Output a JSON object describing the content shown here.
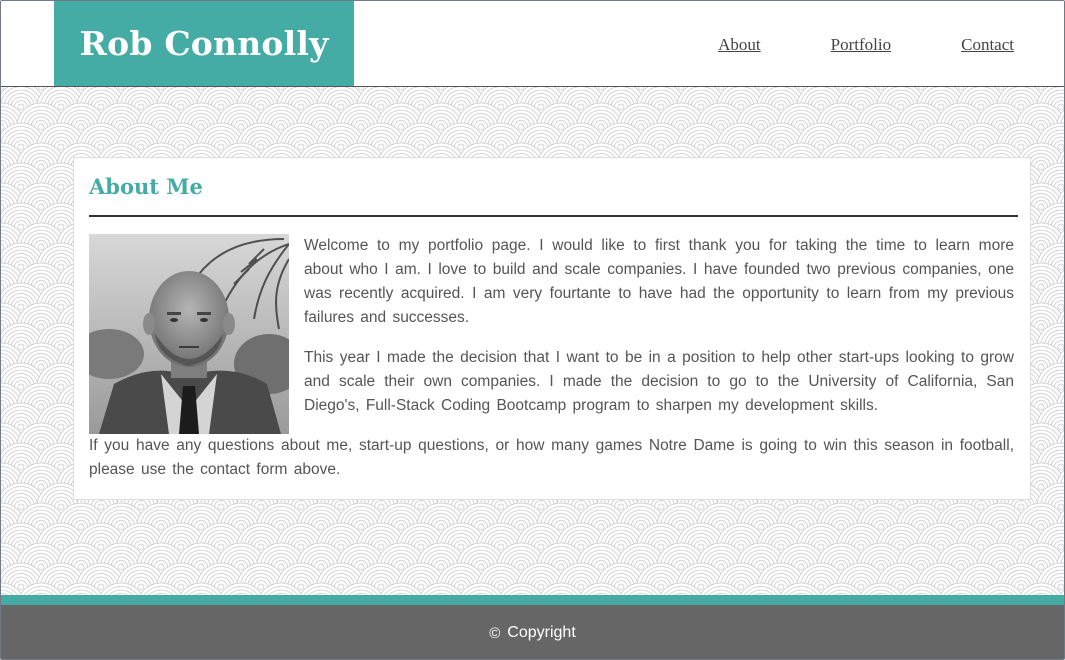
{
  "header": {
    "brand": "Rob Connolly",
    "nav": [
      "About",
      "Portfolio",
      "Contact"
    ]
  },
  "about": {
    "title": "About Me",
    "paragraphs": [
      "Welcome to my portfolio page. I would like to first thank you for taking the time to learn more about who I am. I love to build and scale companies. I have founded two previous companies, one was recently acquired. I am very fourtante to have had the opportunity to learn from my previous failures and successes.",
      "This year I made the decision that I want to be in a position to help other start-ups looking to grow and scale their own companies. I made the decision to go to the University of California, San Diego's, Full-Stack Coding Bootcamp program to sharpen my development skills.",
      "If you have any questions about me, start-up questions, or how many games Notre Dame is going to win this season in football, please use the contact form above."
    ]
  },
  "footer": {
    "symbol": "©",
    "text": "Copyright"
  },
  "colors": {
    "brand": "#45aca5",
    "footer": "#666666"
  }
}
